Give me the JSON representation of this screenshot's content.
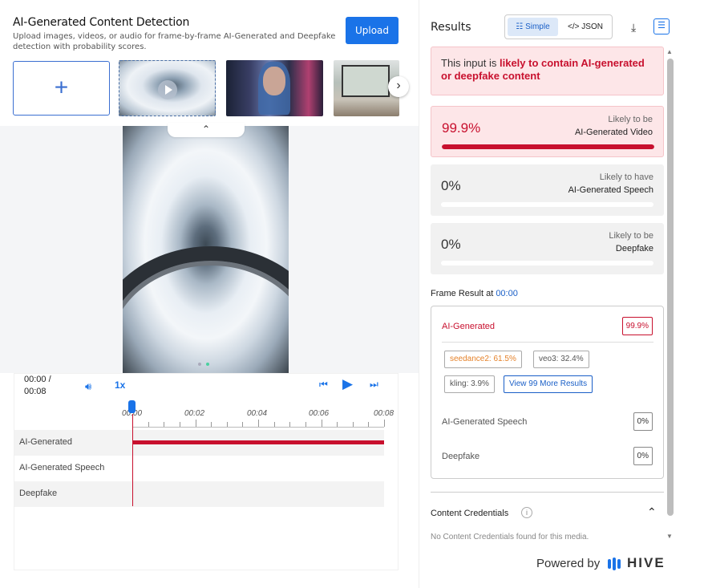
{
  "header": {
    "title": "AI-Generated Content Detection",
    "subtitle": "Upload images, videos, or audio for frame-by-frame AI-Generated and Deepfake detection with probability scores.",
    "upload_label": "Upload"
  },
  "thumbnails": {
    "add_label": "+"
  },
  "player": {
    "current_time": "00:00 /",
    "duration": "00:08",
    "speed": "1x",
    "ticks": [
      "00:00",
      "00:02",
      "00:04",
      "00:06",
      "00:08"
    ],
    "tracks": [
      {
        "label": "AI-Generated"
      },
      {
        "label": "AI-Generated Speech"
      },
      {
        "label": "Deepfake"
      }
    ]
  },
  "results": {
    "title": "Results",
    "view_simple": "Simple",
    "view_json": "</> JSON",
    "verdict_prefix": "This input is ",
    "verdict_emphasis": "likely to contain AI-generated or deepfake content",
    "cards": [
      {
        "value": "99.9%",
        "cap1": "Likely to be",
        "cap2": "AI-Generated Video",
        "fill": 0.999
      },
      {
        "value": "0%",
        "cap1": "Likely to have",
        "cap2": "AI-Generated Speech",
        "fill": 0
      },
      {
        "value": "0%",
        "cap1": "Likely to be",
        "cap2": "Deepfake",
        "fill": 0
      }
    ],
    "frame_label": "Frame Result at ",
    "frame_time": "00:00",
    "frame": {
      "ai_label": "AI-Generated",
      "ai_value": "99.9%",
      "chips": [
        "seedance2: 61.5%",
        "veo3: 32.4%",
        "kling: 3.9%"
      ],
      "more": "View 99 More Results",
      "speech_label": "AI-Generated Speech",
      "speech_value": "0%",
      "deepfake_label": "Deepfake",
      "deepfake_value": "0%"
    },
    "credentials_title": "Content Credentials",
    "credentials_note": "No Content Credentials found for this media."
  },
  "footer": {
    "powered_by": "Powered by",
    "brand": "HIVE"
  },
  "colors": {
    "accent": "#1a73e8",
    "danger": "#c8102e"
  }
}
